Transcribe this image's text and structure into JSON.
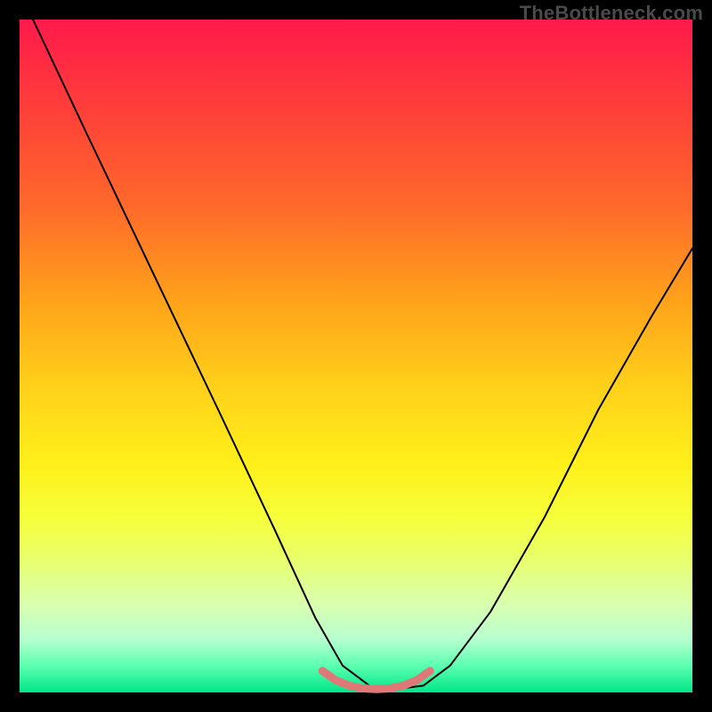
{
  "watermark": "TheBottleneck.com",
  "chart_data": {
    "type": "line",
    "title": "",
    "xlabel": "",
    "ylabel": "",
    "xlim": [
      0,
      100
    ],
    "ylim": [
      0,
      100
    ],
    "series": [
      {
        "name": "bottleneck-curve",
        "color": "#000000",
        "stroke_width": 2,
        "x": [
          2,
          10,
          20,
          30,
          38,
          44,
          48,
          52,
          56,
          60,
          64,
          70,
          78,
          86,
          94,
          100
        ],
        "values": [
          100,
          83,
          62,
          41,
          24,
          11,
          4,
          1,
          0.5,
          1,
          4,
          12,
          26,
          42,
          56,
          66
        ]
      },
      {
        "name": "optimal-band",
        "color": "#e07878",
        "stroke_width": 9,
        "x": [
          45,
          47,
          49,
          51,
          53,
          55,
          57,
          59,
          61
        ],
        "values": [
          3.2,
          1.8,
          1.0,
          0.6,
          0.5,
          0.6,
          1.0,
          1.8,
          3.2
        ]
      }
    ],
    "gradient_stops": [
      {
        "pct": 0,
        "color": "#ff1a4b"
      },
      {
        "pct": 12,
        "color": "#ff3b3b"
      },
      {
        "pct": 28,
        "color": "#ff6a2a"
      },
      {
        "pct": 42,
        "color": "#ffa31a"
      },
      {
        "pct": 55,
        "color": "#ffd21a"
      },
      {
        "pct": 66,
        "color": "#ffef1a"
      },
      {
        "pct": 74,
        "color": "#f6ff3a"
      },
      {
        "pct": 80,
        "color": "#e9ff6a"
      },
      {
        "pct": 87,
        "color": "#d8ffb0"
      },
      {
        "pct": 92,
        "color": "#b8ffd0"
      },
      {
        "pct": 96,
        "color": "#5cffb0"
      },
      {
        "pct": 100,
        "color": "#00e78a"
      }
    ]
  }
}
